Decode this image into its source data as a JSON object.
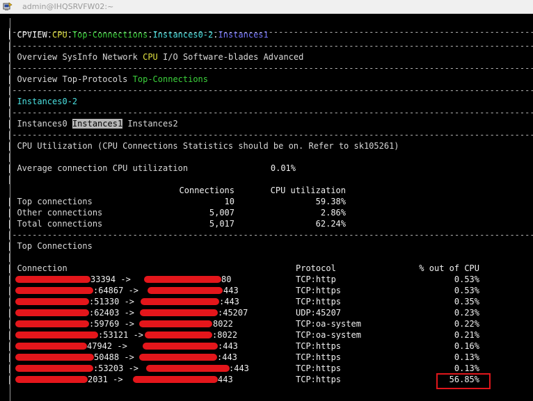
{
  "window": {
    "title": "admin@IHQSRVFW02:~"
  },
  "dash_line": "|------------------------------------------------------------------------------------------------------------",
  "breadcrumb": {
    "prefix": "| CPVIEW.",
    "cpu": "CPU",
    "sep1": ".",
    "top_connections": "Top-Connections",
    "sep2": ".",
    "instances_group": "Instances0-2",
    "sep3": ".",
    "instance": "Instances1"
  },
  "main_tabs": {
    "bar": "| ",
    "items": [
      "Overview",
      "SysInfo",
      "Network",
      "CPU",
      "I/O",
      "Software-blades",
      "Advanced"
    ]
  },
  "sub_tabs": {
    "bar": "| ",
    "items": [
      "Overview",
      "Top-Protocols",
      "Top-Connections"
    ]
  },
  "instance_group": {
    "bar": "| ",
    "label": "Instances0-2"
  },
  "instance_tabs": {
    "bar": "| ",
    "items": [
      "Instances0",
      "Instances1",
      "Instances2"
    ]
  },
  "cpu_util": {
    "heading": "| CPU Utilization (CPU Connections Statistics should be on. Refer to sk105261)",
    "avg_label": "| Average connection CPU utilization",
    "avg_value": "0.01%",
    "pipe": "|",
    "headers": {
      "connections": "Connections",
      "cpu": "CPU utilization"
    },
    "rows": [
      {
        "label": "| Top connections",
        "connections": "10",
        "cpu": "59.38%"
      },
      {
        "label": "| Other connections",
        "connections": "5,007",
        "cpu": "2.86%"
      },
      {
        "label": "| Total connections",
        "connections": "5,017",
        "cpu": "62.24%"
      }
    ]
  },
  "top_connections": {
    "heading": "| Top Connections",
    "pipe": "|",
    "headers": {
      "connection": "| Connection",
      "protocol": "Protocol",
      "cpu": "% out of CPU"
    },
    "rows": [
      {
        "connection": "33394 -> ",
        "dst_port": "80",
        "protocol": "TCP:http",
        "cpu": "0.53%"
      },
      {
        "connection": ":64867 -> ",
        "dst_port": "443",
        "protocol": "TCP:https",
        "cpu": "0.53%"
      },
      {
        "connection": ":51330 -> ",
        "dst_port": ":443",
        "protocol": "TCP:https",
        "cpu": "0.35%"
      },
      {
        "connection": ":62403 -> ",
        "dst_port": ":45207",
        "protocol": "UDP:45207",
        "cpu": "0.23%"
      },
      {
        "connection": ":59769 -> ",
        "dst_port": "8022",
        "protocol": "TCP:oa-system",
        "cpu": "0.22%"
      },
      {
        "connection": ":53121 -> ",
        "dst_port": ":8022",
        "protocol": "TCP:oa-system",
        "cpu": "0.21%"
      },
      {
        "connection": "47942 -> ",
        "dst_port": ":443",
        "protocol": "TCP:https",
        "cpu": "0.16%"
      },
      {
        "connection": "50488 -> ",
        "dst_port": ":443",
        "protocol": "TCP:https",
        "cpu": "0.13%"
      },
      {
        "connection": ":53203 -> ",
        "dst_port": ":443",
        "protocol": "TCP:https",
        "cpu": "0.13%"
      },
      {
        "connection": "2031 -> ",
        "dst_port": "443",
        "protocol": "TCP:https",
        "cpu": "56.85%"
      }
    ]
  },
  "annotation": {
    "highlighted_value": "56.85%",
    "color": "#e0161b"
  },
  "colors": {
    "background": "#000000",
    "text": "#d8d8d8",
    "cpu_tab": "#e0e040",
    "green": "#3cd23c",
    "cyan": "#4ae0e0",
    "blue": "#7878ff",
    "selected_tab_bg": "#b8b8b8",
    "redaction": "#e4161b"
  }
}
